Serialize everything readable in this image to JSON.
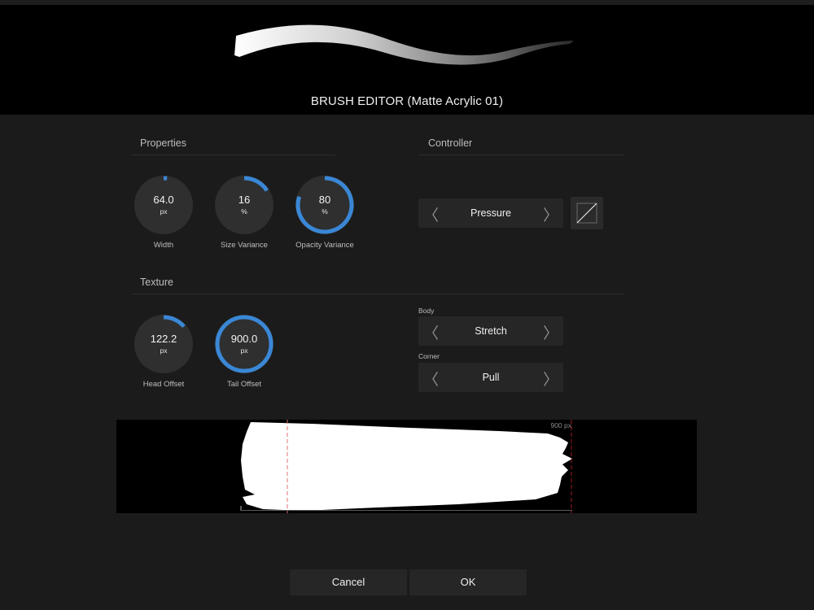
{
  "window": {
    "title": "BRUSH EDITOR (Matte Acrylic 01)"
  },
  "colors": {
    "accent": "#3a87d6",
    "knob_fill": "#2f2f2f",
    "background": "#1b1b1b",
    "head_marker": "#e07070",
    "tail_marker": "#a01c1c"
  },
  "properties": {
    "title": "Properties",
    "knobs": [
      {
        "label": "Width",
        "value": "64.0",
        "unit": "px",
        "progress": 0.02
      },
      {
        "label": "Size Variance",
        "value": "16",
        "unit": "%",
        "progress": 0.16
      },
      {
        "label": "Opacity Variance",
        "value": "80",
        "unit": "%",
        "progress": 0.8
      }
    ]
  },
  "controller": {
    "title": "Controller",
    "selector": {
      "value": "Pressure",
      "prev_icon": "chevron-left-icon",
      "next_icon": "chevron-right-icon"
    },
    "curve_button_icon": "linear-curve-icon"
  },
  "texture": {
    "title": "Texture",
    "knobs": [
      {
        "label": "Head Offset",
        "value": "122.2",
        "unit": "px",
        "progress": 0.136
      },
      {
        "label": "Tail Offset",
        "value": "900.0",
        "unit": "px",
        "progress": 1.0
      }
    ],
    "body": {
      "caption": "Body",
      "value": "Stretch"
    },
    "corner": {
      "caption": "Corner",
      "value": "Pull"
    },
    "preview_length_label": "900 px"
  },
  "footer": {
    "cancel_label": "Cancel",
    "ok_label": "OK"
  }
}
